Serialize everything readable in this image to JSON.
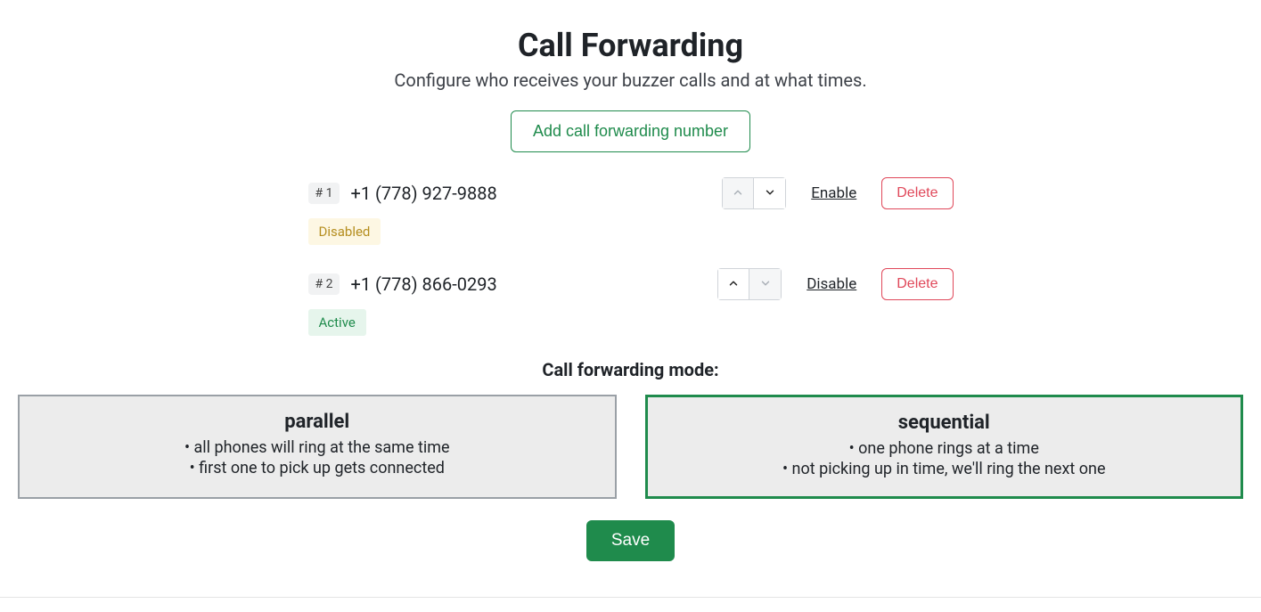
{
  "header": {
    "title": "Call Forwarding",
    "subtitle": "Configure who receives your buzzer calls and at what times.",
    "add_button": "Add call forwarding number"
  },
  "numbers": [
    {
      "order_label": "# 1",
      "phone": "+1 (778) 927-9888",
      "toggle_label": "Enable",
      "delete_label": "Delete",
      "status_label": "Disabled",
      "status_kind": "disabled",
      "up_disabled": true,
      "down_disabled": false
    },
    {
      "order_label": "# 2",
      "phone": "+1 (778) 866-0293",
      "toggle_label": "Disable",
      "delete_label": "Delete",
      "status_label": "Active",
      "status_kind": "active",
      "up_disabled": false,
      "down_disabled": true
    }
  ],
  "mode": {
    "title": "Call forwarding mode:",
    "options": [
      {
        "key": "parallel",
        "heading": "parallel",
        "line1": "• all phones will ring at the same time",
        "line2": "• first one to pick up gets connected",
        "selected": false
      },
      {
        "key": "sequential",
        "heading": "sequential",
        "line1": "• one phone rings at a time",
        "line2": "• not picking up in time, we'll ring the next one",
        "selected": true
      }
    ]
  },
  "footer": {
    "save": "Save"
  }
}
